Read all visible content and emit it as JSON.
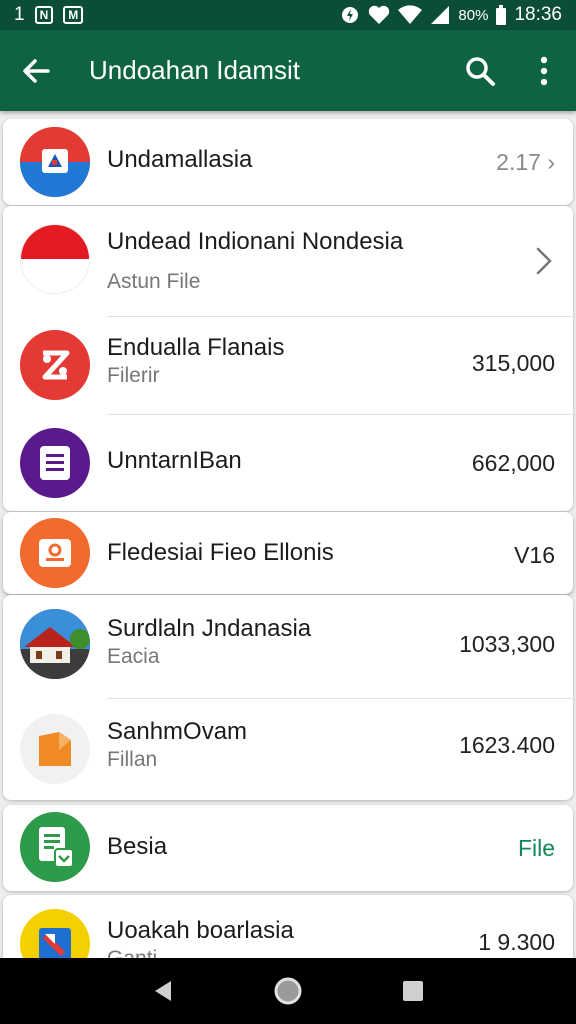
{
  "status_bar": {
    "left_text": "1",
    "chip1": "N",
    "chip2": "M",
    "battery": "80%",
    "time": "18:36"
  },
  "app_bar": {
    "title": "Undoahan Idamsit",
    "icons": [
      "arrow-back-icon",
      "search-icon",
      "more-vert-icon"
    ]
  },
  "items": [
    {
      "title": "Undamallasia",
      "value": "2.17 ›"
    },
    {
      "title": "Undead Indionani Nondesia",
      "subtitle": "Astun File"
    },
    {
      "title": "Endualla Flanais",
      "subtitle": "Filerir",
      "value": "315,000"
    },
    {
      "title": "UnntarnIBan",
      "value": "662,000"
    },
    {
      "title": "Fledesiai Fieo Ellonis",
      "value": "V16"
    },
    {
      "title": "Surdlaln Jndanasia",
      "subtitle": "Eacia",
      "value": "1033,300"
    },
    {
      "title": "SanhmOvam",
      "subtitle": "Fillan",
      "value": "1623.400"
    },
    {
      "title": "Besia",
      "value": "File"
    },
    {
      "title": "Uoakah boarlasia",
      "subtitle": "Ganti",
      "value": "1 9.300"
    }
  ],
  "colors": {
    "status_bar": "#0b4d36",
    "app_bar": "#0e6343",
    "accent_green": "#13875b",
    "red": "#e53935",
    "purple": "#5b1a8c",
    "orange": "#f26a2e",
    "green": "#2e9b4b",
    "yellow": "#f5d000"
  }
}
